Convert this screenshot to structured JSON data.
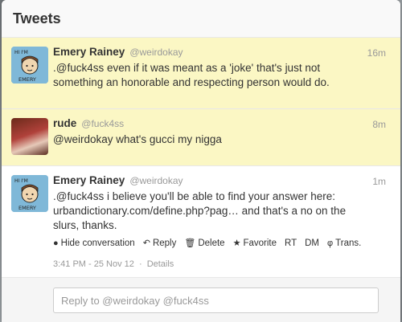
{
  "panel": {
    "title": "Tweets"
  },
  "tweets": [
    {
      "fullname": "Emery Rainey",
      "screenname": "@weirdokay",
      "time": "16m",
      "text": ".@fuck4ss even if it was meant as a 'joke' that's just not something an honorable and respecting person would do.",
      "highlight": true,
      "avatar_text_top": "HI I'M",
      "avatar_text_bottom": "EMERY"
    },
    {
      "fullname": "rude",
      "screenname": "@fuck4ss",
      "time": "8m",
      "text": "@weirdokay what's gucci my nigga",
      "highlight": true
    },
    {
      "fullname": "Emery Rainey",
      "screenname": "@weirdokay",
      "time": "1m",
      "text": ".@fuck4ss i believe you'll be able to find your answer here: urbandictionary.com/define.php?pag… and that's a no on the slurs, thanks.",
      "highlight": false,
      "avatar_text_top": "HI I'M",
      "avatar_text_bottom": "EMERY",
      "actions": {
        "hide": "Hide conversation",
        "reply": "Reply",
        "delete": "Delete",
        "favorite": "Favorite",
        "rt": "RT",
        "dm": "DM",
        "trans": "Trans."
      },
      "timestamp": "3:41 PM - 25 Nov 12",
      "separator": "·",
      "details": "Details"
    }
  ],
  "reply": {
    "placeholder": "Reply to @weirdokay @fuck4ss"
  },
  "colors": {
    "highlight": "#fbf7c4",
    "muted": "#999999",
    "text": "#333333"
  },
  "icons": [
    "speech-bubble-icon",
    "reply-arrow-icon",
    "trash-icon",
    "star-icon",
    "phi-icon"
  ]
}
